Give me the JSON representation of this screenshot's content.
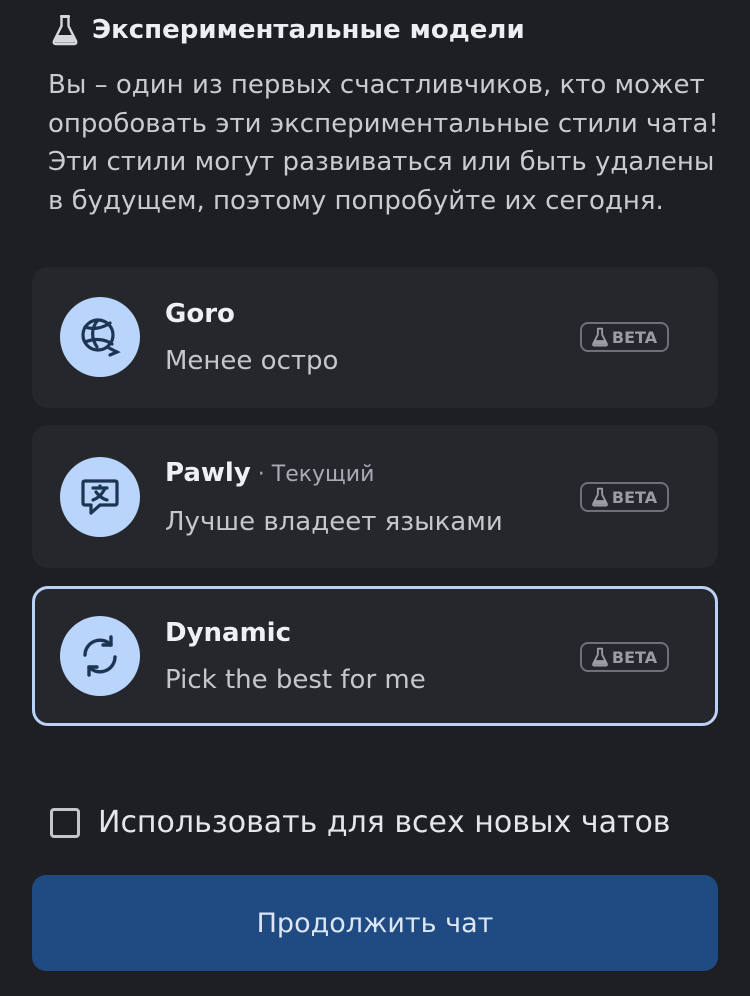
{
  "header": {
    "title": "Экспериментальные модели",
    "icon": "flask-icon"
  },
  "intro": "Вы – один из первых счастливчиков, кто может опробовать эти экспериментальные стили чата! Эти стили могут развиваться или быть удалены в будущем, поэтому попробуйте их сегодня.",
  "models": [
    {
      "name": "Goro",
      "current": "",
      "description": "Менее остро",
      "badge": "BETA",
      "icon": "volleyball-icon",
      "selected": false
    },
    {
      "name": "Pawly",
      "current": " · Текущий",
      "description": "Лучше владеет языками",
      "badge": "BETA",
      "icon": "translate-message-icon",
      "selected": false
    },
    {
      "name": "Dynamic",
      "current": "",
      "description": "Pick the best for me",
      "badge": "BETA",
      "icon": "refresh-cycle-icon",
      "selected": true
    }
  ],
  "checkbox": {
    "label": "Использовать для всех новых чатов",
    "checked": false
  },
  "continue_button": "Продолжить чат",
  "colors": {
    "background": "#1e1f22",
    "card": "#25272d",
    "selected_border": "#b9d2f5",
    "avatar": "#b9d5fb",
    "button": "#1f4a82"
  }
}
